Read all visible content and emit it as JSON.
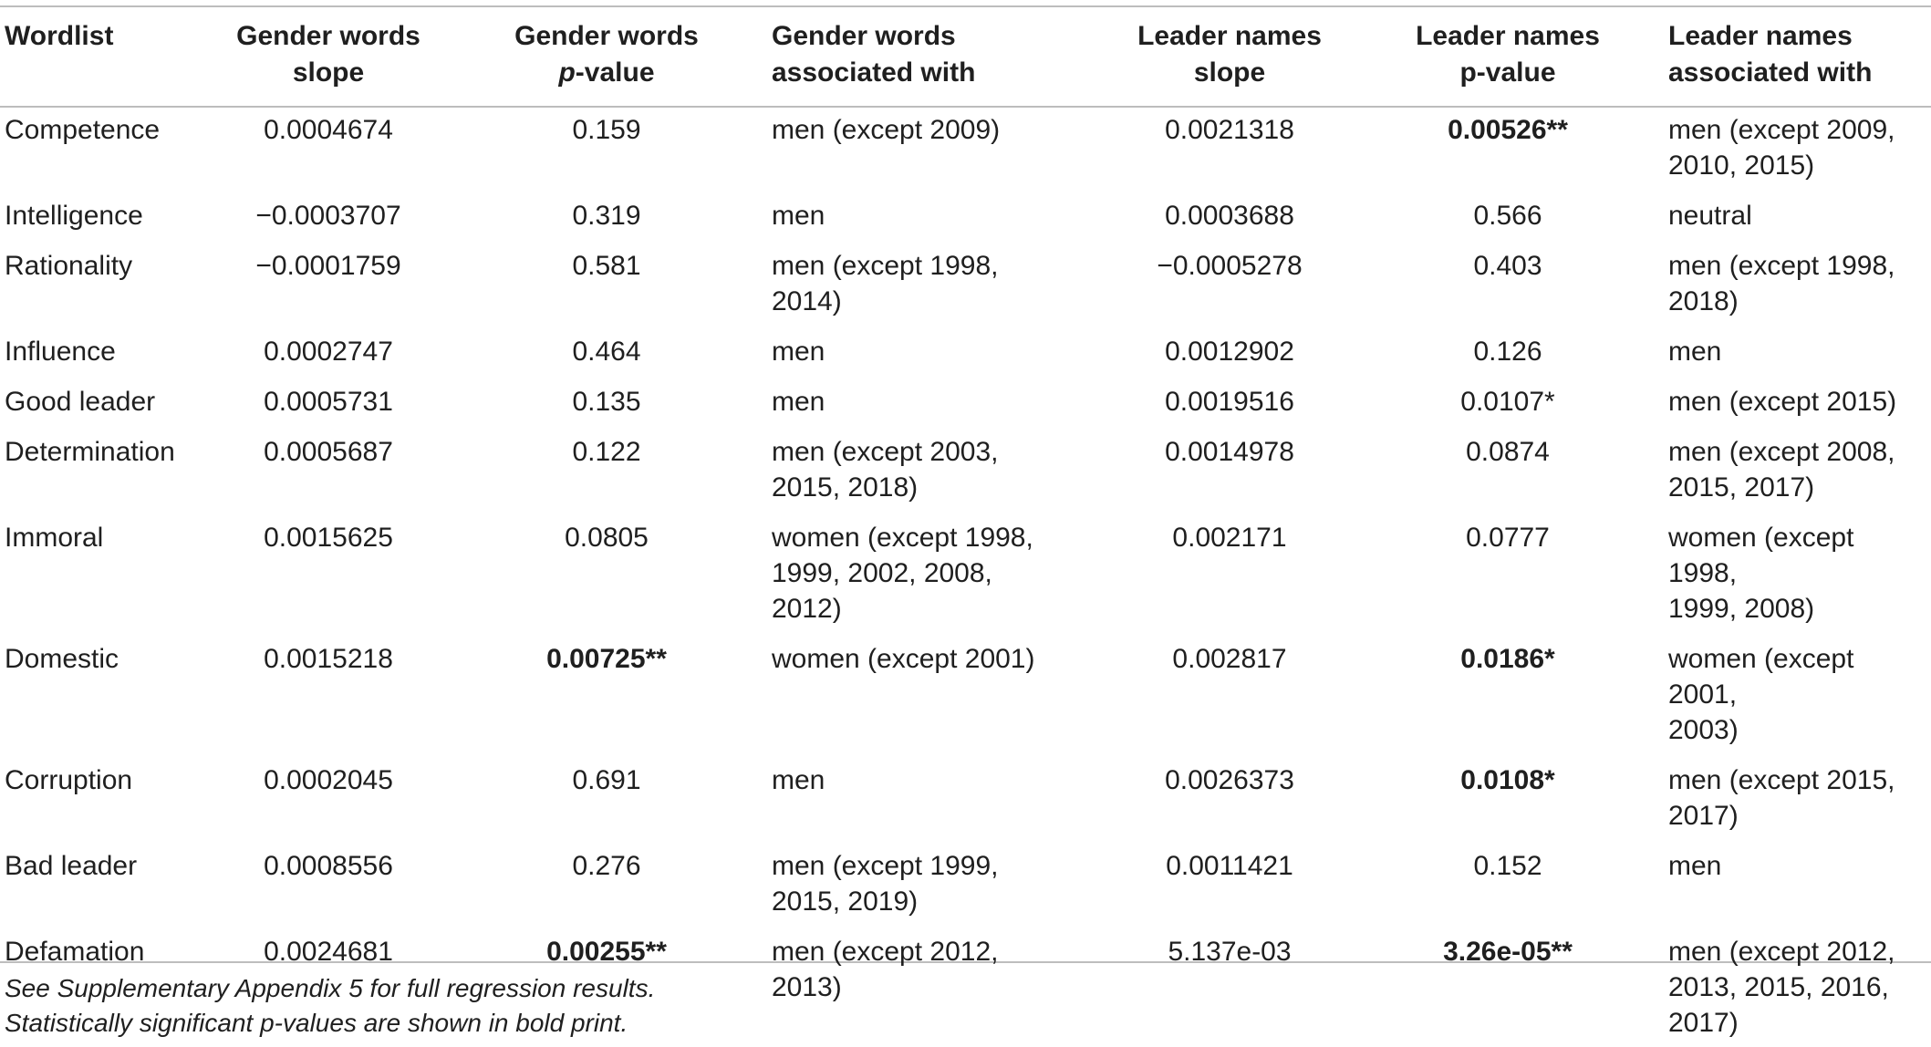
{
  "table": {
    "headers": [
      [
        "Wordlist"
      ],
      [
        "Gender words",
        "slope"
      ],
      [
        "Gender words",
        "p-value"
      ],
      [
        "Gender words",
        "associated with"
      ],
      [
        "Leader names",
        "slope"
      ],
      [
        "Leader names",
        "p-value"
      ],
      [
        "Leader names",
        "associated with"
      ]
    ],
    "rows": [
      [
        "Competence",
        "0.0004674",
        "0.159",
        "men (except 2009)",
        "0.0021318",
        "0.00526**",
        "men (except 2009,\n2010, 2015)"
      ],
      [
        "Intelligence",
        "−0.0003707",
        "0.319",
        "men",
        "0.0003688",
        "0.566",
        "neutral"
      ],
      [
        "Rationality",
        "−0.0001759",
        "0.581",
        "men (except 1998,\n2014)",
        "−0.0005278",
        "0.403",
        "men (except 1998,\n2018)"
      ],
      [
        "Influence",
        "0.0002747",
        "0.464",
        "men",
        "0.0012902",
        "0.126",
        "men"
      ],
      [
        "Good leader",
        "0.0005731",
        "0.135",
        "men",
        "0.0019516",
        "0.0107*",
        "men (except 2015)"
      ],
      [
        "Determination",
        "0.0005687",
        "0.122",
        "men (except 2003,\n2015, 2018)",
        "0.0014978",
        "0.0874",
        "men (except 2008,\n2015, 2017)"
      ],
      [
        "Immoral",
        "0.0015625",
        "0.0805",
        "women (except 1998,\n1999, 2002, 2008,\n2012)",
        "0.002171",
        "0.0777",
        "women (except 1998,\n1999, 2008)"
      ],
      [
        "Domestic",
        "0.0015218",
        "0.00725**",
        "women (except 2001)",
        "0.002817",
        "0.0186*",
        "women (except 2001,\n2003)"
      ],
      [
        "Corruption",
        "0.0002045",
        "0.691",
        "men",
        "0.0026373",
        "0.0108*",
        "men (except 2015,\n2017)"
      ],
      [
        "Bad leader",
        "0.0008556",
        "0.276",
        "men (except 1999,\n2015, 2019)",
        "0.0011421",
        "0.152",
        "men"
      ],
      [
        "Defamation",
        "0.0024681",
        "0.00255**",
        "men (except 2012,\n2013)",
        "5.137e-03",
        "3.26e-05**",
        "men (except 2012,\n2013, 2015, 2016,\n2017)"
      ]
    ],
    "bold_cells": [
      [
        0,
        5
      ],
      [
        7,
        2
      ],
      [
        7,
        5
      ],
      [
        8,
        5
      ],
      [
        10,
        2
      ],
      [
        10,
        5
      ]
    ]
  },
  "notes": [
    "See Supplementary Appendix 5 for full regression results.",
    "Statistically significant p-values are shown in bold print."
  ]
}
